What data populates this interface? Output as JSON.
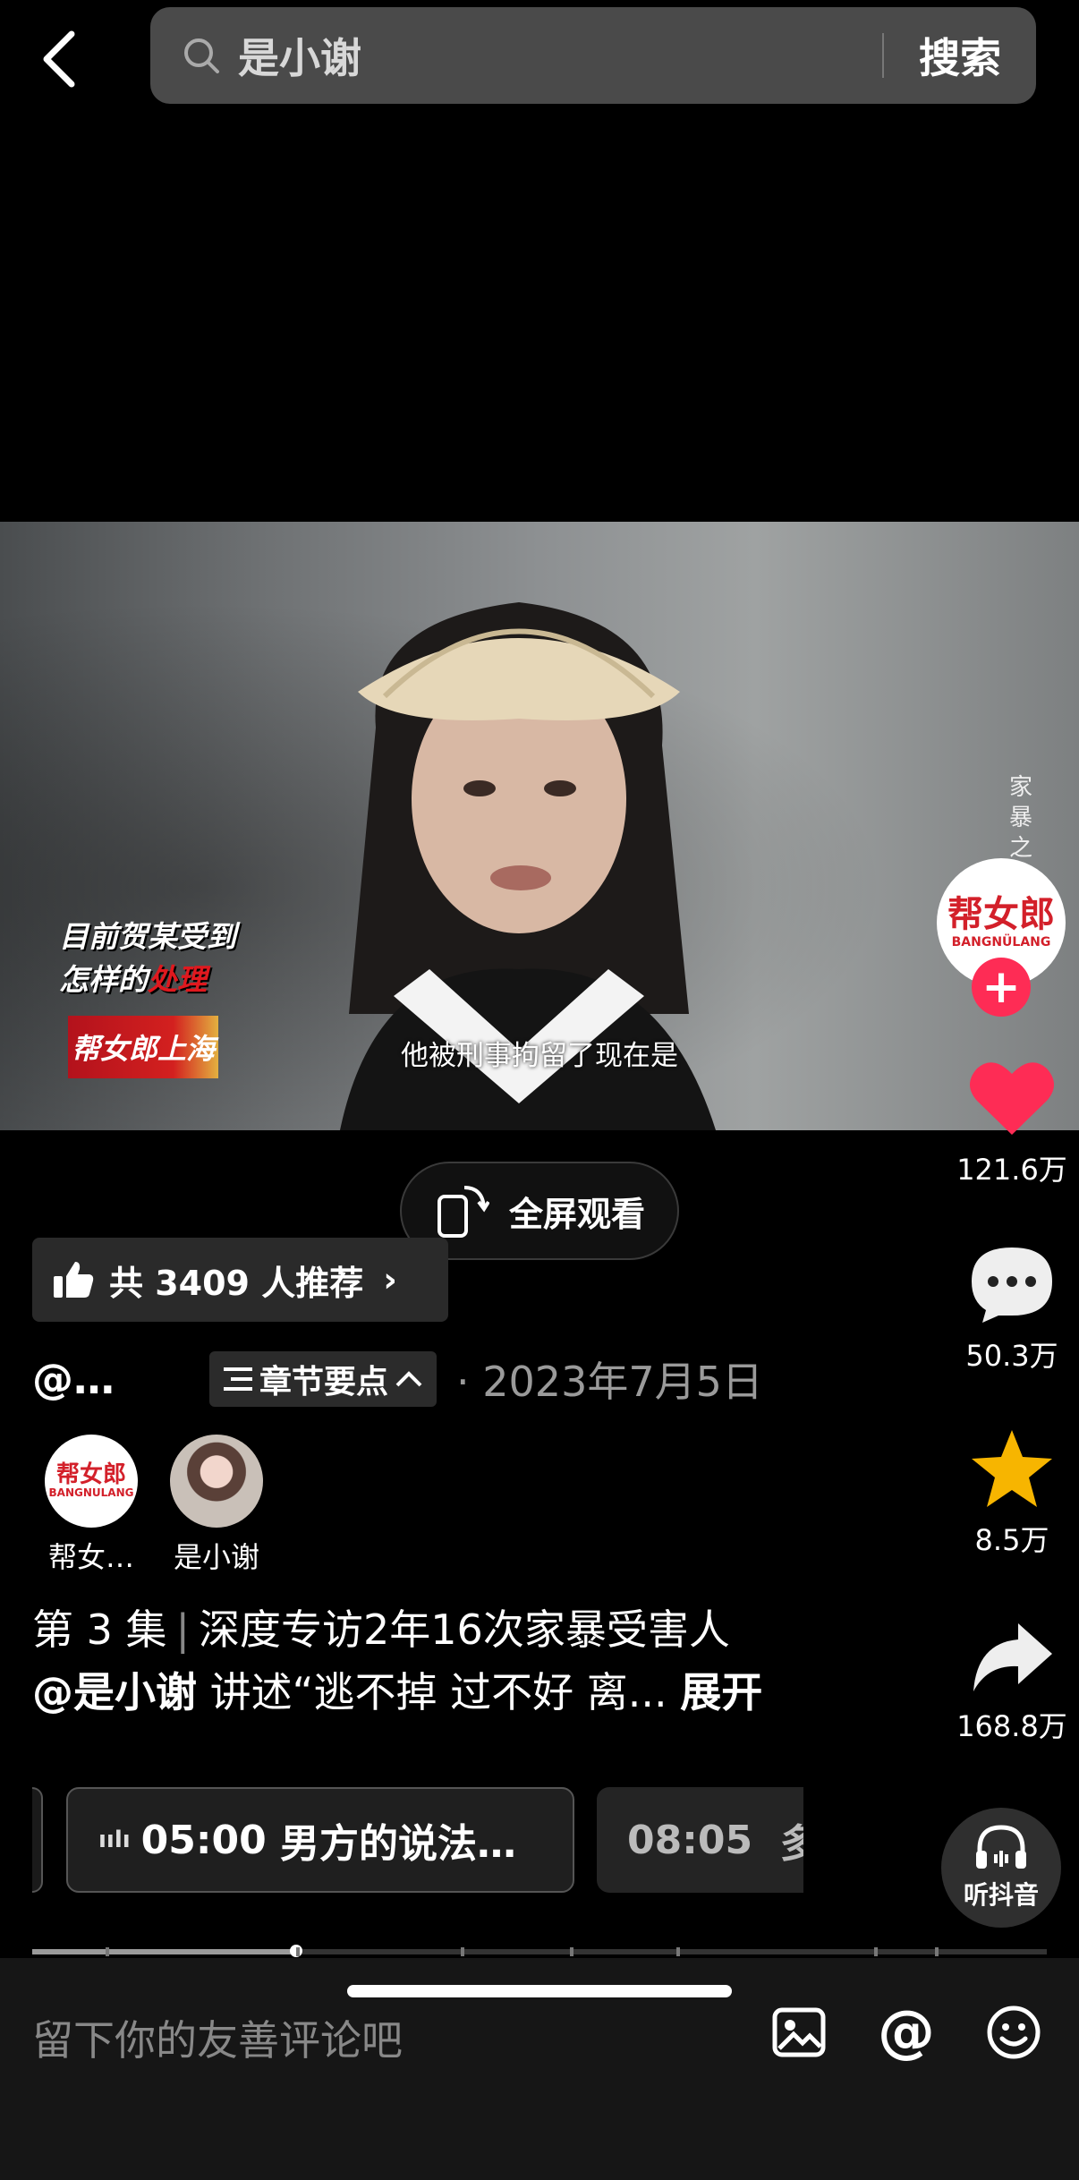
{
  "search": {
    "query": "是小谢",
    "button_label": "搜索"
  },
  "video": {
    "title_line1": "目前贺某受到",
    "title_line2_a": "怎样的",
    "title_line2_b": "处理",
    "logo_text": "帮女郎上海",
    "subtitle": "他被刑事拘留了现在是",
    "side_text": "家暴之",
    "fullscreen_label": "全屏观看"
  },
  "recommend": {
    "label": "共 3409 人推荐"
  },
  "author": {
    "handle": "@…",
    "chapter_label": "章节要点",
    "date": "2023年7月5日"
  },
  "coauthors": [
    {
      "name": "帮女…",
      "avatar_text": "帮女郎",
      "avatar_sub": "BANGNULANG"
    },
    {
      "name": "是小谢"
    }
  ],
  "description": {
    "episode": "第 3 集",
    "separator": "|",
    "title": "深度专访2年16次家暴受害人",
    "mention": "@是小谢",
    "text": " 讲述“逃不掉 过不好 离...",
    "expand": "展开"
  },
  "chapters": [
    {
      "time": "05:00",
      "label": "男方的说法…"
    },
    {
      "time": "08:05",
      "label": "多"
    }
  ],
  "progress": {
    "fraction": 0.26,
    "ticks": [
      0.072,
      0.26,
      0.422,
      0.53,
      0.635,
      0.83,
      0.89
    ]
  },
  "rail": {
    "author_avatar_text": "帮女郎",
    "author_avatar_sub": "BANGNÜLANG",
    "likes": "121.6万",
    "comments": "50.3万",
    "favorites": "8.5万",
    "shares": "168.8万",
    "listen_label": "听抖音"
  },
  "comment": {
    "placeholder": "留下你的友善评论吧"
  },
  "colors": {
    "like": "#fe2c55",
    "favorite": "#f7b500",
    "brand_red": "#d3202a"
  }
}
